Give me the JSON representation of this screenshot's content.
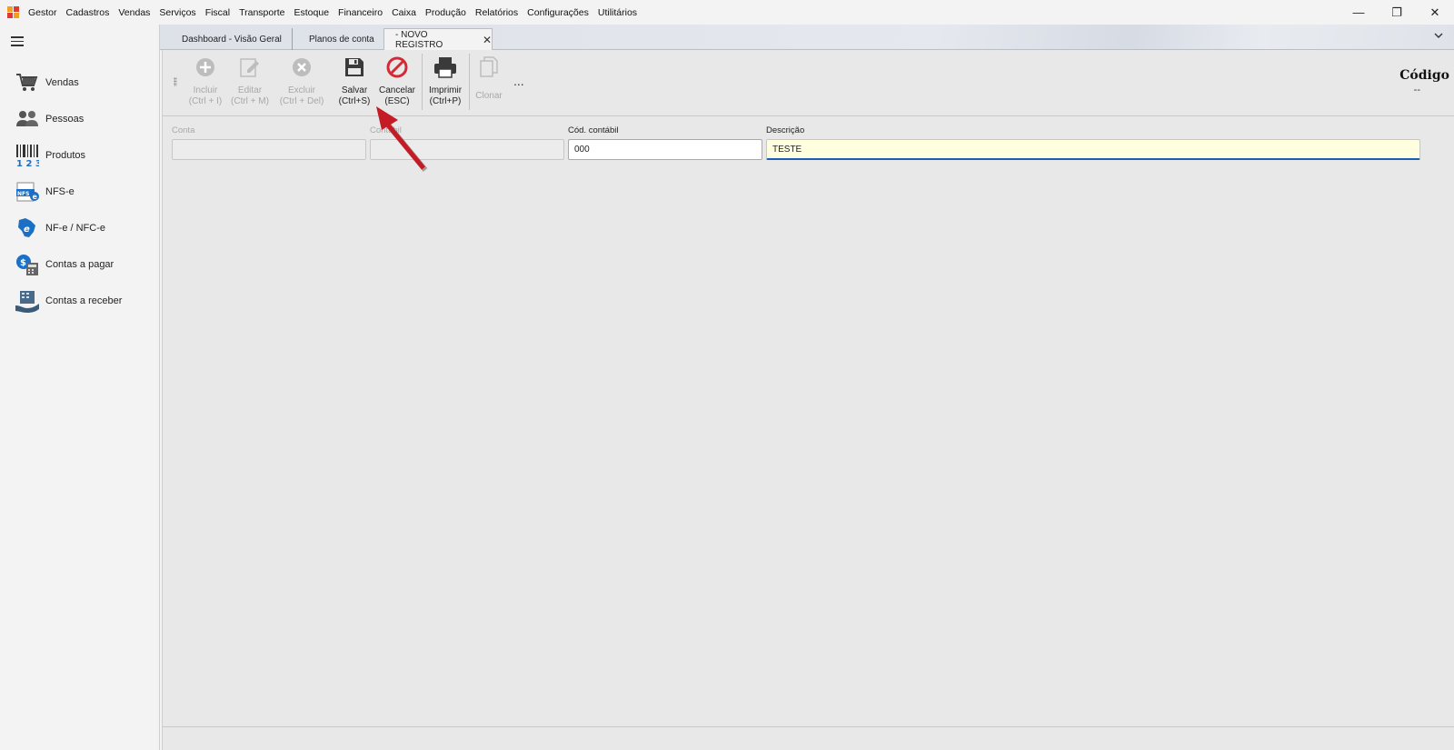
{
  "menu": {
    "items": [
      "Gestor",
      "Cadastros",
      "Vendas",
      "Serviços",
      "Fiscal",
      "Transporte",
      "Estoque",
      "Financeiro",
      "Caixa",
      "Produção",
      "Relatórios",
      "Configurações",
      "Utilitários"
    ]
  },
  "window_controls": {
    "minimize": "—",
    "restore": "❐",
    "close": "✕"
  },
  "sidebar": {
    "items": [
      {
        "label": "Vendas",
        "icon": "cart-icon"
      },
      {
        "label": "Pessoas",
        "icon": "people-icon"
      },
      {
        "label": "Produtos",
        "icon": "barcode-icon"
      },
      {
        "label": "NFS-e",
        "icon": "nfse-icon"
      },
      {
        "label": "NF-e / NFC-e",
        "icon": "nfe-icon"
      },
      {
        "label": "Contas a pagar",
        "icon": "bills-pay-icon"
      },
      {
        "label": "Contas a receber",
        "icon": "bills-receive-icon"
      }
    ]
  },
  "tabs": [
    {
      "label": "Dashboard - Visão Geral"
    },
    {
      "label": "Planos de conta"
    },
    {
      "label": "- NOVO REGISTRO",
      "close": "✕"
    }
  ],
  "toolbar": {
    "incluir": {
      "line1": "Incluir",
      "line2": "(Ctrl + I)"
    },
    "editar": {
      "line1": "Editar",
      "line2": "(Ctrl + M)"
    },
    "excluir": {
      "line1": "Excluir",
      "line2": "(Ctrl + Del)"
    },
    "salvar": {
      "line1": "Salvar",
      "line2": "(Ctrl+S)"
    },
    "cancelar": {
      "line1": "Cancelar",
      "line2": "(ESC)"
    },
    "imprimir": {
      "line1": "Imprimir",
      "line2": "(Ctrl+P)"
    },
    "clonar": {
      "line1": "Clonar"
    },
    "more": "..."
  },
  "header": {
    "codigo_title": "Código",
    "codigo_value": "--"
  },
  "form": {
    "conta": {
      "label": "Conta",
      "value": ""
    },
    "contabil": {
      "label": "Contábil",
      "value": ""
    },
    "cod_contabil": {
      "label": "Cód. contábil",
      "value": "000"
    },
    "descricao": {
      "label": "Descrição",
      "value": "TESTE"
    }
  },
  "colors": {
    "accent_red": "#c41b24",
    "focus_blue": "#1b5fb5",
    "focus_bg": "#ffffdf"
  }
}
